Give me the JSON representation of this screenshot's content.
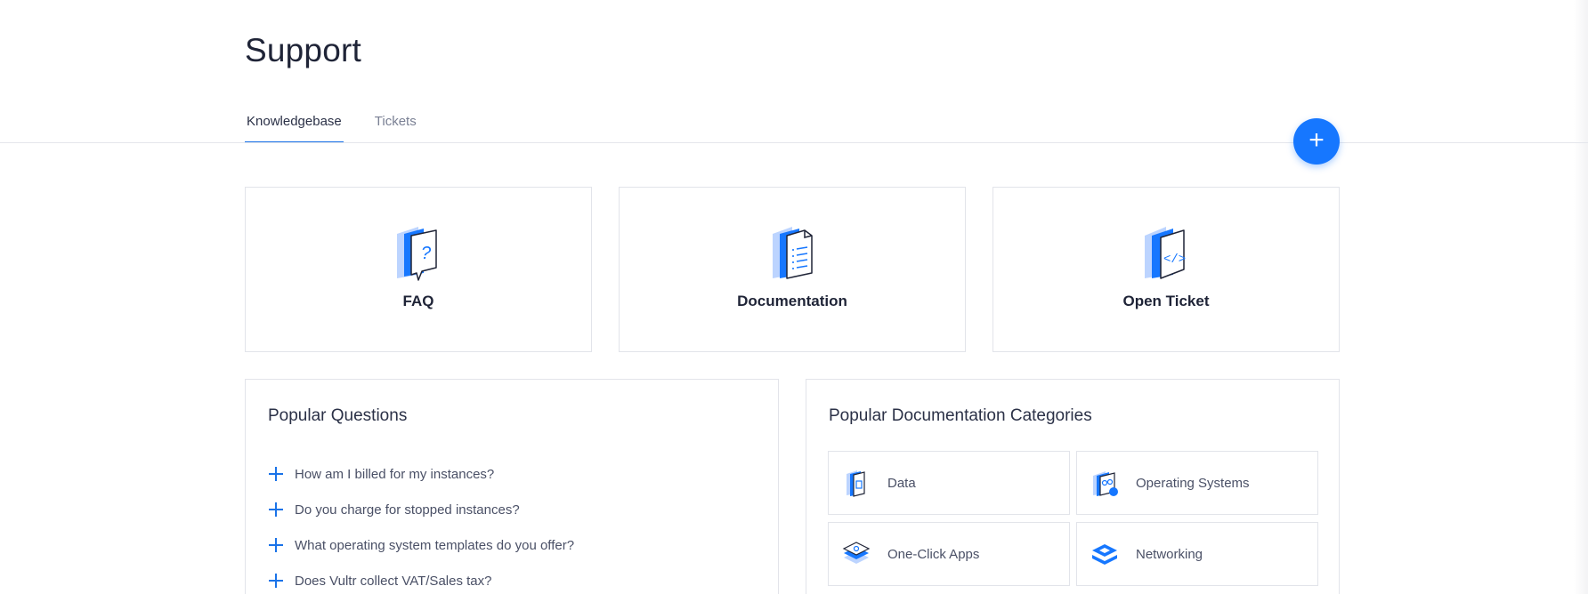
{
  "header": {
    "title": "Support"
  },
  "tabs": [
    {
      "label": "Knowledgebase",
      "active": true
    },
    {
      "label": "Tickets",
      "active": false
    }
  ],
  "fab": {
    "label": "+"
  },
  "cards": [
    {
      "label": "FAQ",
      "icon": "faq-icon"
    },
    {
      "label": "Documentation",
      "icon": "documentation-icon"
    },
    {
      "label": "Open Ticket",
      "icon": "open-ticket-icon"
    }
  ],
  "popular_questions": {
    "title": "Popular Questions",
    "items": [
      "How am I billed for my instances?",
      "Do you charge for stopped instances?",
      "What operating system templates do you offer?",
      "Does Vultr collect VAT/Sales tax?"
    ]
  },
  "popular_categories": {
    "title": "Popular Documentation Categories",
    "items": [
      {
        "label": "Data",
        "icon": "data-icon"
      },
      {
        "label": "Operating Systems",
        "icon": "operating-systems-icon"
      },
      {
        "label": "One-Click Apps",
        "icon": "one-click-apps-icon"
      },
      {
        "label": "Networking",
        "icon": "networking-icon"
      }
    ]
  },
  "colors": {
    "accent": "#1677ff",
    "text": "#2b3147",
    "muted": "#7a8094",
    "border": "#e2e4ea"
  }
}
